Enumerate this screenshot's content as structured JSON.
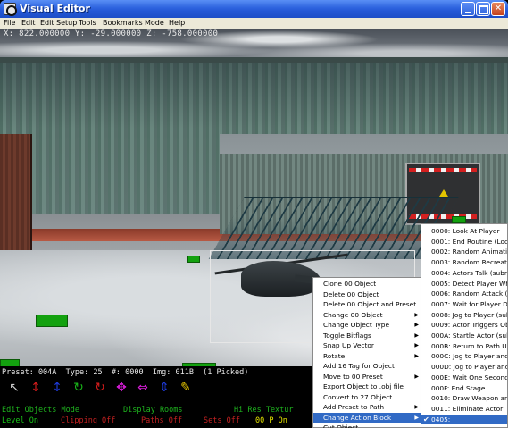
{
  "window": {
    "title": "Visual Editor",
    "minimize_glyph": "",
    "maximize_glyph": "",
    "close_glyph": ""
  },
  "menubar": [
    "File",
    "Edit",
    "Edit Setup",
    "Tools",
    "Bookmarks",
    "Mode",
    "Help"
  ],
  "coords_text": "X: 822.000000  Y: -29.000000  Z: -758.000000",
  "status": {
    "preset_line": "Preset: 004A  Type: 25  #: 0000  Img: 011B  (1 Picked)",
    "mode_items": [
      "Edit Objects Mode",
      "Display Rooms",
      "Hi Res Textur"
    ],
    "status_items": [
      "Level On",
      "Clipping Off",
      "Paths Off",
      "Sets Off",
      "00 P On"
    ]
  },
  "toolbar_icons": [
    {
      "name": "arrow-cursor-icon",
      "glyph": "↖",
      "color": "#d0d0d0"
    },
    {
      "name": "move-up-down-icon",
      "glyph": "↕",
      "color": "#d41c1c"
    },
    {
      "name": "move-vertical-icon",
      "glyph": "↕",
      "color": "#1e3ad8"
    },
    {
      "name": "rotate-green-icon",
      "glyph": "↻",
      "color": "#19b219"
    },
    {
      "name": "rotate-red-icon",
      "glyph": "↻",
      "color": "#d41c1c"
    },
    {
      "name": "move-cross-icon",
      "glyph": "✥",
      "color": "#d61cd6"
    },
    {
      "name": "scale-diagonal-icon",
      "glyph": "⇔",
      "color": "#d61cd6"
    },
    {
      "name": "scale-vertical-icon",
      "glyph": "⇕",
      "color": "#1e3ad8"
    },
    {
      "name": "pencil-icon",
      "glyph": "✎",
      "color": "#e3c400"
    }
  ],
  "context_menu": {
    "items": [
      {
        "label": "Clone 00 Object",
        "submenu": false
      },
      {
        "label": "Delete 00 Object",
        "submenu": false
      },
      {
        "label": "Delete 00 Object and Preset",
        "submenu": false
      },
      {
        "label": "Change 00 Object",
        "submenu": true
      },
      {
        "label": "Change Object Type",
        "submenu": true
      },
      {
        "label": "Toggle Bitflags",
        "submenu": true
      },
      {
        "label": "Snap Up Vector",
        "submenu": true
      },
      {
        "label": "Rotate",
        "submenu": true
      },
      {
        "label": "Add 16 Tag for Object",
        "submenu": false
      },
      {
        "label": "Move to 00 Preset",
        "submenu": true
      },
      {
        "label": "Export Object to .obj file",
        "submenu": false
      },
      {
        "label": "Convert to 27 Object",
        "submenu": false
      },
      {
        "label": "Add Preset to Path",
        "submenu": true
      },
      {
        "label": "Change Action Block",
        "submenu": true,
        "highlighted": true
      },
      {
        "label": "Cut Object",
        "submenu": false
      }
    ]
  },
  "sub_menu": {
    "items": [
      {
        "label": "0000: Look At Player"
      },
      {
        "label": "0001: End Routine (Loo"
      },
      {
        "label": "0002: Random Animatio"
      },
      {
        "label": "0003: Random Recreati"
      },
      {
        "label": "0004: Actors Talk (subro"
      },
      {
        "label": "0005: Detect Player Wh"
      },
      {
        "label": "0006: Random Attack (S"
      },
      {
        "label": "0007: Wait for Player D"
      },
      {
        "label": "0008: Jog to Player (sub"
      },
      {
        "label": "0009: Actor Triggers Ob"
      },
      {
        "label": "000A: Startle Actor (sub"
      },
      {
        "label": "000B: Return to Path U"
      },
      {
        "label": "000C: Jog to Player and"
      },
      {
        "label": "000D: Jog to Player and"
      },
      {
        "label": "000E: Wait One Second"
      },
      {
        "label": "000F: End Stage"
      },
      {
        "label": "0010: Draw Weapon and"
      },
      {
        "label": "0011: Eliminate Actor"
      },
      {
        "label": "0405:",
        "highlighted": true,
        "checked": true
      }
    ]
  },
  "colors": {
    "titlebar_blue": "#2458d6",
    "menu_highlight": "#316ac5",
    "mode_green": "#1eb21e",
    "status_red": "#c42121",
    "status_yellow": "#e3e300",
    "object_green": "#13a10f"
  }
}
